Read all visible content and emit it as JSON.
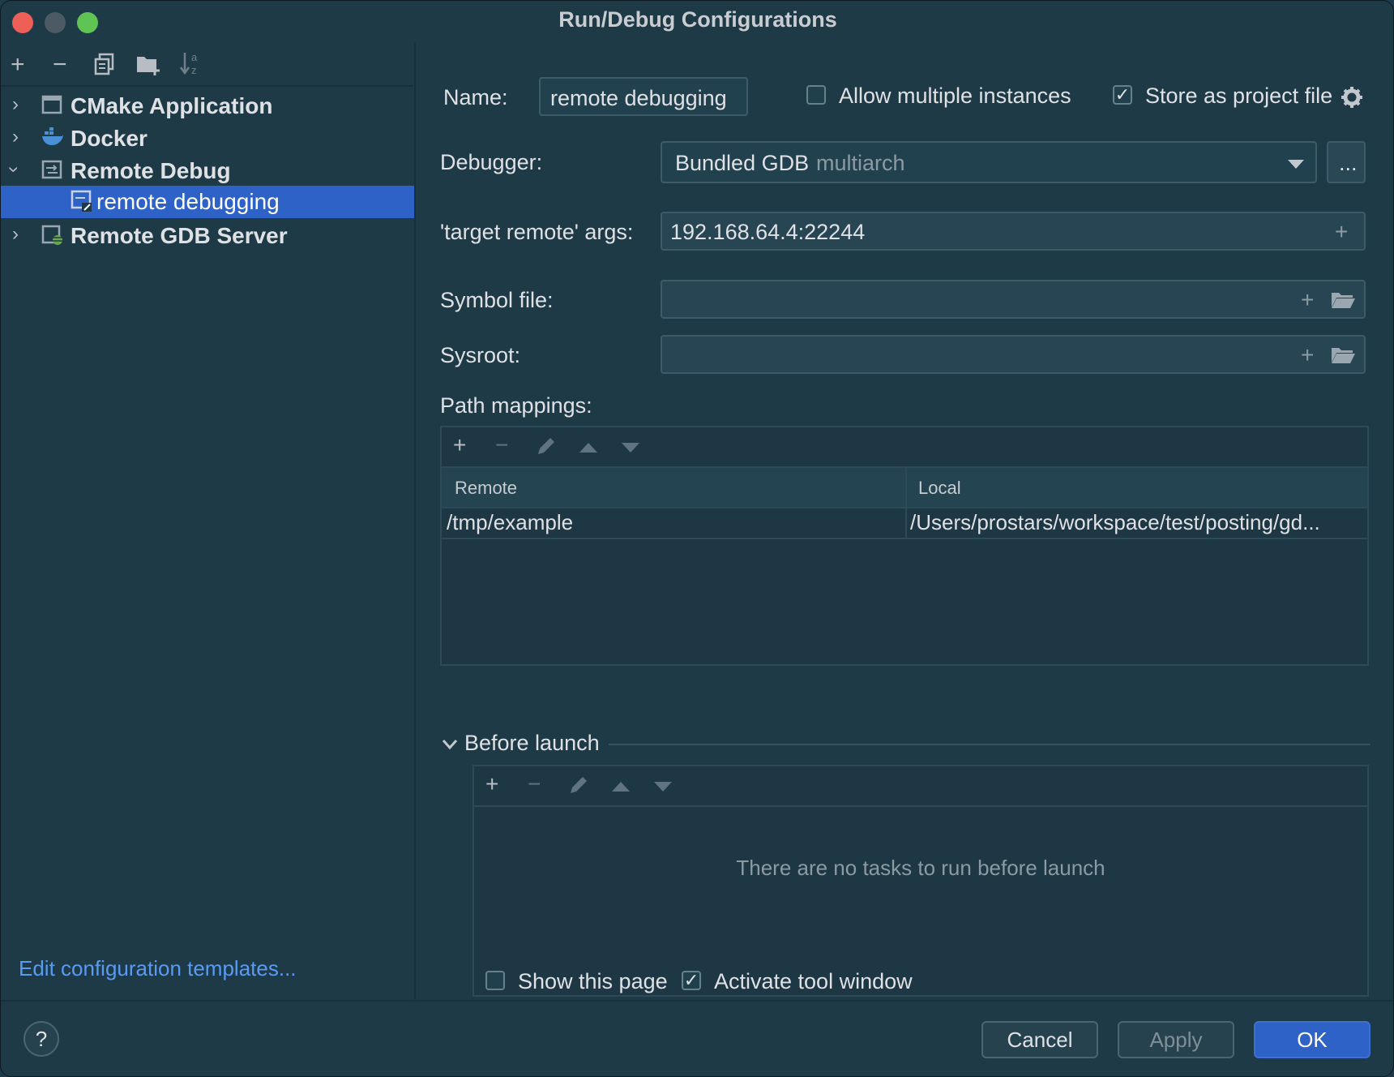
{
  "window": {
    "title": "Run/Debug Configurations"
  },
  "left_toolbar": {
    "icons": [
      "add-icon",
      "remove-icon",
      "copy-icon",
      "new-folder-icon",
      "sort-alpha-icon"
    ]
  },
  "tree": {
    "items": [
      {
        "label": "CMake Application",
        "icon": "cmake-app-icon",
        "expanded": false
      },
      {
        "label": "Docker",
        "icon": "docker-icon",
        "expanded": false
      },
      {
        "label": "Remote Debug",
        "icon": "remote-debug-icon",
        "expanded": true
      },
      {
        "label": "remote debugging",
        "icon": "remote-debug-config-icon",
        "selected": true
      },
      {
        "label": "Remote GDB Server",
        "icon": "remote-gdb-server-icon",
        "expanded": false
      }
    ]
  },
  "edit_templates_link": "Edit configuration templates...",
  "form": {
    "name_label": "Name:",
    "name_value": "remote debugging",
    "allow_multiple_label": "Allow multiple instances",
    "allow_multiple_checked": false,
    "store_project_label": "Store as project file",
    "store_project_checked": true,
    "debugger_label": "Debugger:",
    "debugger_value": "Bundled GDB",
    "debugger_suffix": "multiarch",
    "browse_button": "...",
    "target_label": "'target remote' args:",
    "target_value": "192.168.64.4:22244",
    "symbol_label": "Symbol file:",
    "symbol_value": "",
    "sysroot_label": "Sysroot:",
    "sysroot_value": ""
  },
  "path_mappings": {
    "label": "Path mappings:",
    "columns": [
      "Remote",
      "Local"
    ],
    "rows": [
      {
        "remote": "/tmp/example",
        "local": "/Users/prostars/workspace/test/posting/gd..."
      }
    ]
  },
  "before_launch": {
    "label": "Before launch",
    "empty_text": "There are no tasks to run before launch",
    "show_page_label": "Show this page",
    "show_page_checked": false,
    "activate_label": "Activate tool window",
    "activate_checked": true
  },
  "footer": {
    "help": "?",
    "cancel": "Cancel",
    "apply": "Apply",
    "ok": "OK"
  },
  "colors": {
    "background": "#1f3a47",
    "selection": "#2f62c7",
    "link": "#5a9bf2",
    "close": "#ee5f57",
    "minimize": "#4c5a63",
    "zoom": "#5fc454"
  }
}
